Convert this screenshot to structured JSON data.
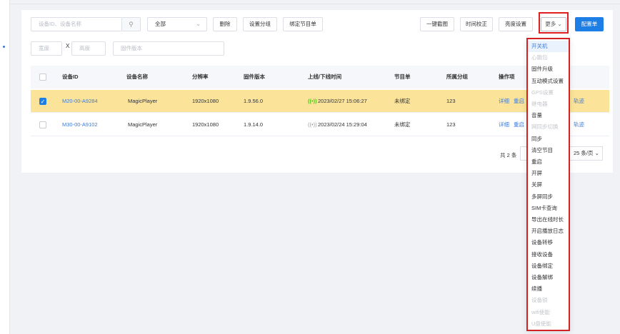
{
  "toolbar": {
    "search_placeholder": "设备ID、设备名称",
    "search_icon": "search-icon",
    "status_select": "全部",
    "delete": "删除",
    "set_group": "设置分组",
    "bind_playlist": "绑定节目单",
    "screenshot": "一键截图",
    "time_sync": "时间校正",
    "brightness": "亮度设置",
    "more": "更多",
    "config": "配置单"
  },
  "filters": {
    "width_placeholder": "宽度",
    "x": "X",
    "height_placeholder": "高度",
    "firmware_placeholder": "固件版本"
  },
  "table": {
    "headers": [
      "设备ID",
      "设备名称",
      "分辨率",
      "固件版本",
      "上线/下线时间",
      "节目单",
      "所属分组",
      "操作项"
    ],
    "rows": [
      {
        "id": "M20-00-A9284",
        "name": "MagicPlayer",
        "res": "1920x1080",
        "fw": "1.9.56.0",
        "signal": "((•))",
        "time": "2023/02/27 15:06:27",
        "playlist": "未绑定",
        "group": "123",
        "op1": "详细",
        "op2": "重启",
        "op3": "轨迹",
        "checked": true
      },
      {
        "id": "M30-00-A9102",
        "name": "MagicPlayer",
        "res": "1920x1080",
        "fw": "1.9.14.0",
        "signal": "((•))",
        "time": "2023/02/24 15:29:04",
        "playlist": "未绑定",
        "group": "123",
        "op1": "详细",
        "op2": "重启",
        "op3": "轨迹",
        "checked": false
      }
    ]
  },
  "pager": {
    "total": "共 2 条",
    "page_size": "25 条/页"
  },
  "menu": {
    "items": [
      {
        "label": "开关机",
        "state": "active"
      },
      {
        "label": "心跳包",
        "state": "disabled"
      },
      {
        "label": "固件升级",
        "state": "normal"
      },
      {
        "label": "互动模式设置",
        "state": "normal"
      },
      {
        "label": "GPS设置",
        "state": "disabled"
      },
      {
        "label": "继电器",
        "state": "disabled"
      },
      {
        "label": "音量",
        "state": "normal"
      },
      {
        "label": "网同步切换",
        "state": "disabled"
      },
      {
        "label": "同步",
        "state": "normal"
      },
      {
        "label": "清空节目",
        "state": "normal"
      },
      {
        "label": "重启",
        "state": "normal"
      },
      {
        "label": "开屏",
        "state": "normal"
      },
      {
        "label": "关屏",
        "state": "normal"
      },
      {
        "label": "多屏同步",
        "state": "normal"
      },
      {
        "label": "SIM卡查询",
        "state": "normal"
      },
      {
        "label": "导出在线时长",
        "state": "normal"
      },
      {
        "label": "开启播放日志",
        "state": "normal"
      },
      {
        "label": "设备转移",
        "state": "normal"
      },
      {
        "label": "接收设备",
        "state": "normal"
      },
      {
        "label": "设备绑定",
        "state": "normal"
      },
      {
        "label": "设备解绑",
        "state": "normal"
      },
      {
        "label": "续播",
        "state": "normal"
      },
      {
        "label": "设备锁",
        "state": "disabled"
      },
      {
        "label": "wifi使能",
        "state": "disabled"
      },
      {
        "label": "U盘使能",
        "state": "disabled"
      }
    ]
  },
  "colors": {
    "primary": "#1d7fe6",
    "link": "#3d7bd8",
    "selected_row": "#fbe49a",
    "highlight_border": "#d42222",
    "online": "#52c41a"
  }
}
